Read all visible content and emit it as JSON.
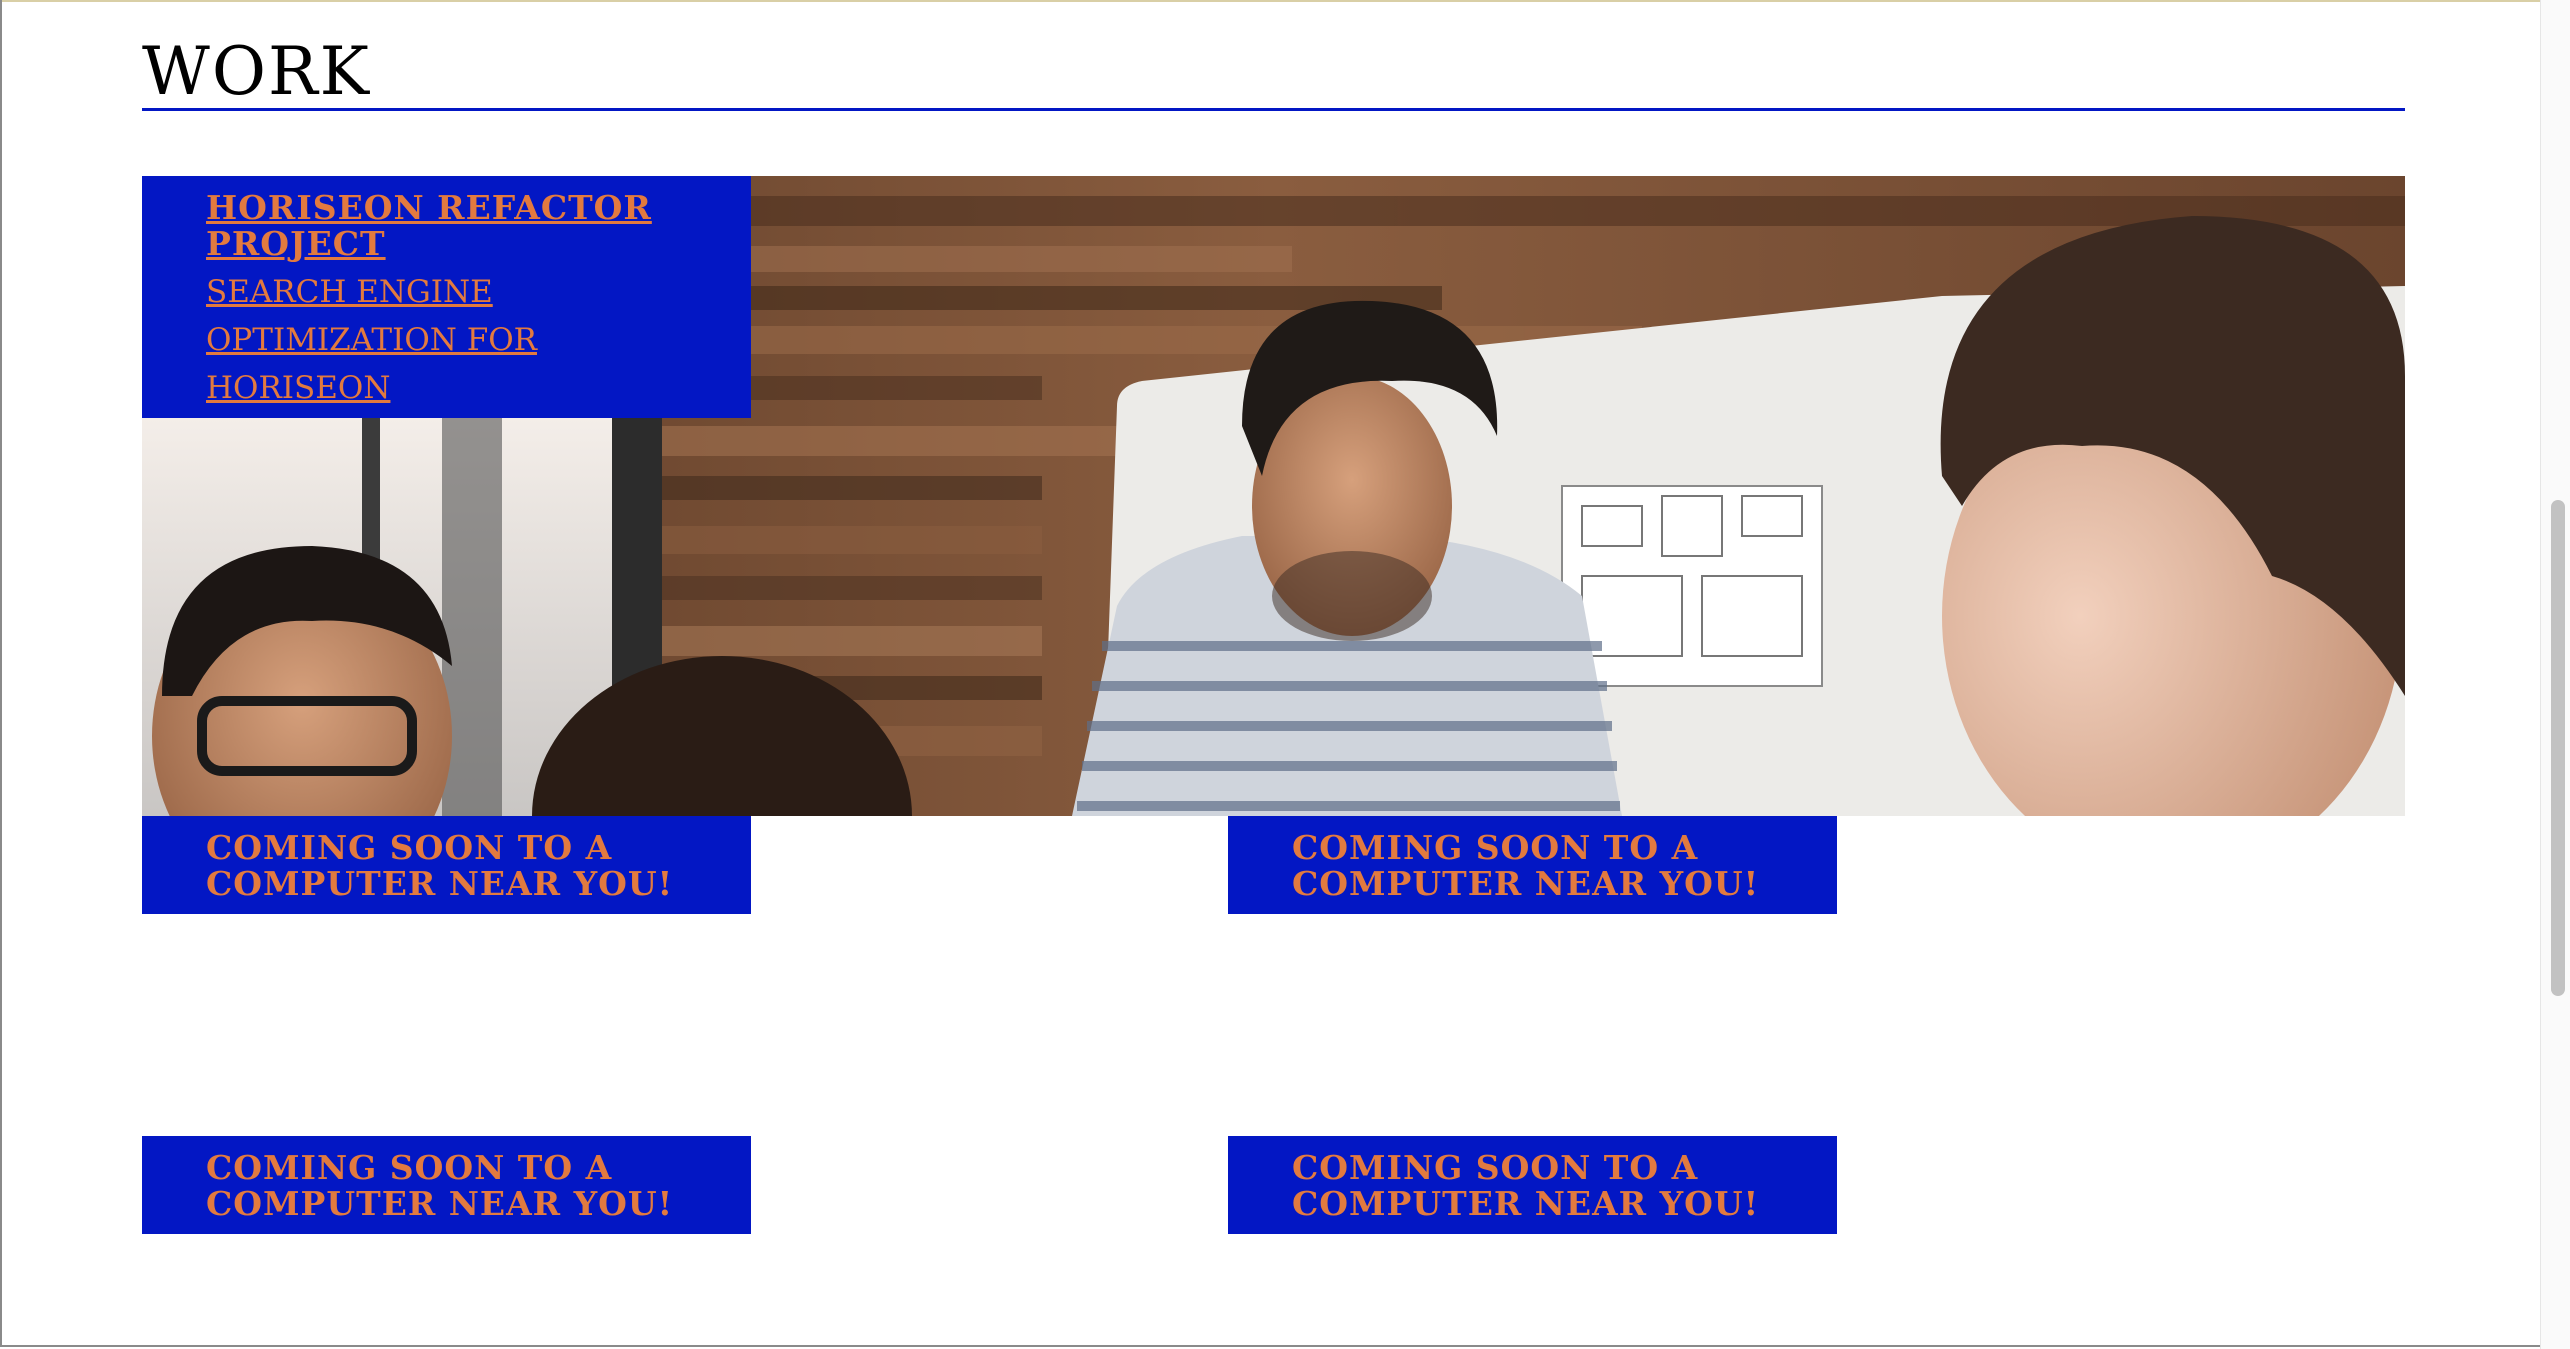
{
  "section": {
    "title": "WORK"
  },
  "featured": {
    "heading": "HORISEON REFACTOR PROJECT",
    "subheading": "SEARCH ENGINE OPTIMIZATION FOR HORISEON"
  },
  "placeholders": [
    {
      "text": "COMING SOON TO A COMPUTER NEAR YOU!"
    },
    {
      "text": "COMING SOON TO A COMPUTER NEAR YOU!"
    },
    {
      "text": "COMING SOON TO A COMPUTER NEAR YOU!"
    },
    {
      "text": "COMING SOON TO A COMPUTER NEAR YOU!"
    }
  ],
  "colors": {
    "accent_blue": "#0317c4",
    "accent_orange": "#e27a3f"
  },
  "icons": {
    "hero": "team-meeting-photo"
  }
}
